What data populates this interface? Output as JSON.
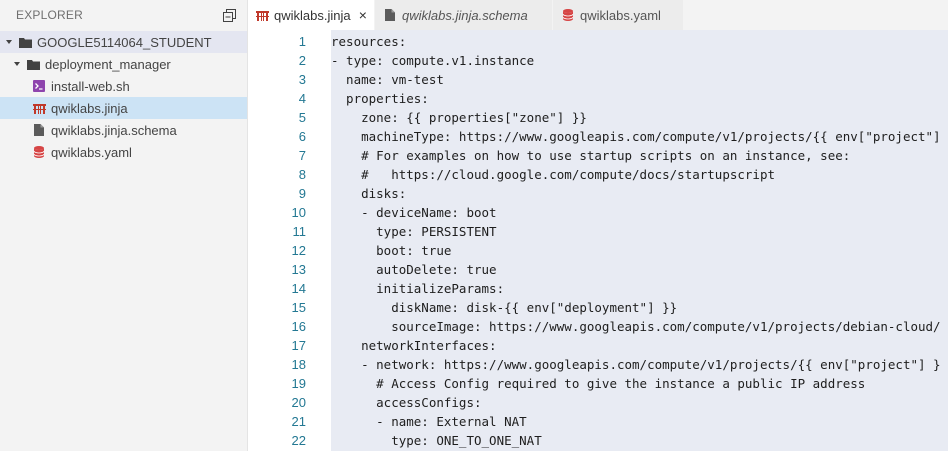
{
  "explorer": {
    "title": "EXPLORER",
    "tree": [
      {
        "label": "GOOGLE5114064_STUDENT",
        "kind": "folder",
        "depth": 0,
        "expanded": true
      },
      {
        "label": "deployment_manager",
        "kind": "folder",
        "depth": 1,
        "expanded": true
      },
      {
        "label": "install-web.sh",
        "kind": "shell",
        "depth": 2
      },
      {
        "label": "qwiklabs.jinja",
        "kind": "jinja",
        "depth": 2,
        "selected": true
      },
      {
        "label": "qwiklabs.jinja.schema",
        "kind": "schema",
        "depth": 2
      },
      {
        "label": "qwiklabs.yaml",
        "kind": "yaml",
        "depth": 2
      }
    ]
  },
  "tabs": [
    {
      "label": "qwiklabs.jinja",
      "icon": "jinja-icon",
      "active": true,
      "close": "×"
    },
    {
      "label": "qwiklabs.jinja.schema",
      "icon": "file-icon",
      "active": false
    },
    {
      "label": "qwiklabs.yaml",
      "icon": "database-icon",
      "active": false
    }
  ],
  "colors": {
    "accent": "#237893",
    "selection": "#cce3f5",
    "jinja_icon": "#c0392b",
    "yaml_icon": "#d64545",
    "shell_icon": "#8e44ad"
  },
  "code": [
    {
      "n": "1",
      "text": "resources:"
    },
    {
      "n": "2",
      "text": "- type: compute.v1.instance"
    },
    {
      "n": "3",
      "text": "  name: vm-test"
    },
    {
      "n": "4",
      "text": "  properties:"
    },
    {
      "n": "5",
      "text": "    zone: {{ properties[\"zone\"] }}"
    },
    {
      "n": "6",
      "text": "    machineType: https://www.googleapis.com/compute/v1/projects/{{ env[\"project\"]"
    },
    {
      "n": "7",
      "text": "    # For examples on how to use startup scripts on an instance, see:"
    },
    {
      "n": "8",
      "text": "    #   https://cloud.google.com/compute/docs/startupscript"
    },
    {
      "n": "9",
      "text": "    disks:"
    },
    {
      "n": "10",
      "text": "    - deviceName: boot"
    },
    {
      "n": "11",
      "text": "      type: PERSISTENT"
    },
    {
      "n": "12",
      "text": "      boot: true"
    },
    {
      "n": "13",
      "text": "      autoDelete: true"
    },
    {
      "n": "14",
      "text": "      initializeParams:"
    },
    {
      "n": "15",
      "text": "        diskName: disk-{{ env[\"deployment\"] }}"
    },
    {
      "n": "16",
      "text": "        sourceImage: https://www.googleapis.com/compute/v1/projects/debian-cloud/"
    },
    {
      "n": "17",
      "text": "    networkInterfaces:"
    },
    {
      "n": "18",
      "text": "    - network: https://www.googleapis.com/compute/v1/projects/{{ env[\"project\"] }"
    },
    {
      "n": "19",
      "text": "      # Access Config required to give the instance a public IP address"
    },
    {
      "n": "20",
      "text": "      accessConfigs:"
    },
    {
      "n": "21",
      "text": "      - name: External NAT"
    },
    {
      "n": "22",
      "text": "        type: ONE_TO_ONE_NAT"
    }
  ]
}
